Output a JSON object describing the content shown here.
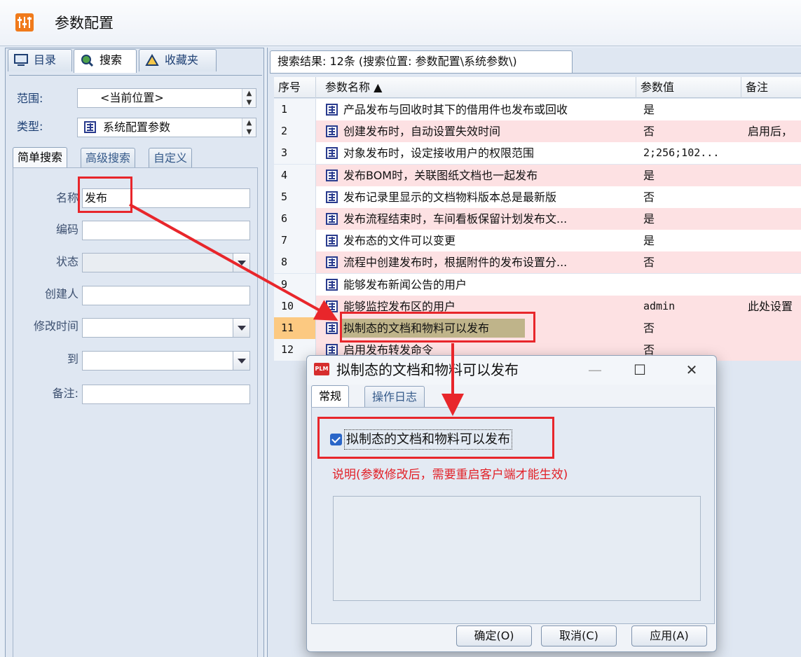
{
  "app": {
    "title": "参数配置"
  },
  "left": {
    "tabs": [
      {
        "label": "目录",
        "icon": "monitor-icon"
      },
      {
        "label": "搜索",
        "icon": "search-icon"
      },
      {
        "label": "收藏夹",
        "icon": "favorites-icon"
      }
    ],
    "scope_label": "范围:",
    "scope_value": "<当前位置>",
    "type_label": "类型:",
    "type_value": "系统配置参数",
    "sub_tabs": [
      "简单搜索",
      "高级搜索",
      "自定义"
    ],
    "fields": {
      "name_label": "名称",
      "name_value": "发布",
      "code_label": "编码",
      "status_label": "状态",
      "creator_label": "创建人",
      "modified_label": "修改时间",
      "to_label": "到",
      "remark_label": "备注:"
    }
  },
  "results": {
    "tab_label": "搜索结果: 12条 (搜索位置: 参数配置\\系统参数\\)",
    "columns": {
      "seq": "序号",
      "name": "参数名称 ▲",
      "value": "参数值",
      "note": "备注"
    },
    "rows": [
      {
        "seq": "1",
        "name": "产品发布与回收时其下的借用件也发布或回收",
        "value": "是",
        "note": ""
      },
      {
        "seq": "2",
        "name": "创建发布时，自动设置失效时间",
        "value": "否",
        "note": "启用后，"
      },
      {
        "seq": "3",
        "name": "对象发布时，设定接收用户的权限范围",
        "value": "2;256;102...",
        "note": ""
      },
      {
        "seq": "4",
        "name": "发布BOM时，关联图纸文档也一起发布",
        "value": "是",
        "note": ""
      },
      {
        "seq": "5",
        "name": "发布记录里显示的文档物料版本总是最新版",
        "value": "否",
        "note": ""
      },
      {
        "seq": "6",
        "name": "发布流程结束时，车间看板保留计划发布文...",
        "value": "是",
        "note": ""
      },
      {
        "seq": "7",
        "name": "发布态的文件可以变更",
        "value": "是",
        "note": ""
      },
      {
        "seq": "8",
        "name": "流程中创建发布时，根据附件的发布设置分...",
        "value": "否",
        "note": ""
      },
      {
        "seq": "9",
        "name": "能够发布新闻公告的用户",
        "value": "",
        "note": ""
      },
      {
        "seq": "10",
        "name": "能够监控发布区的用户",
        "value": "admin",
        "note": "此处设置"
      },
      {
        "seq": "11",
        "name": "拟制态的文档和物料可以发布",
        "value": "否",
        "note": ""
      },
      {
        "seq": "12",
        "name": "启用发布转发命令",
        "value": "否",
        "note": ""
      }
    ]
  },
  "dialog": {
    "title": "拟制态的文档和物料可以发布",
    "tabs": [
      "常规",
      "操作日志"
    ],
    "checkbox_label": "拟制态的文档和物料可以发布",
    "note": "说明(参数修改后，需要重启客户端才能生效)",
    "buttons": {
      "ok": "确定(O)",
      "cancel": "取消(C)",
      "apply": "应用(A)"
    }
  },
  "colors": {
    "accent": "#e8262b",
    "row_alt": "#fde1e3",
    "selected_seq": "#fcc981"
  }
}
